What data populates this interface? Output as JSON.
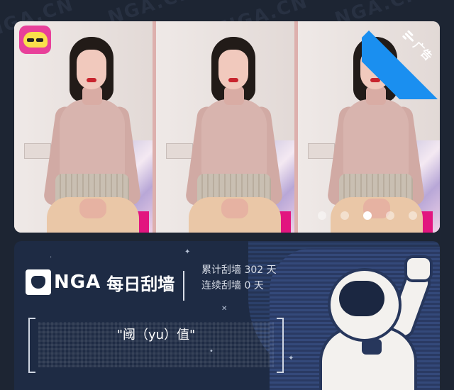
{
  "background": {
    "watermark_text": "NGA.CN"
  },
  "banner": {
    "ad_label": "广告",
    "active_slide": 3,
    "slide_count": 5,
    "accent_color": "#1a8ff0",
    "badge_color": "#e8409a"
  },
  "daily": {
    "brand": "NGA",
    "title": "每日刮墙",
    "stat_total": "累计刮墙 302 天",
    "stat_streak": "连续刮墙 0 天",
    "quote": "\"阈（yu）值\""
  }
}
